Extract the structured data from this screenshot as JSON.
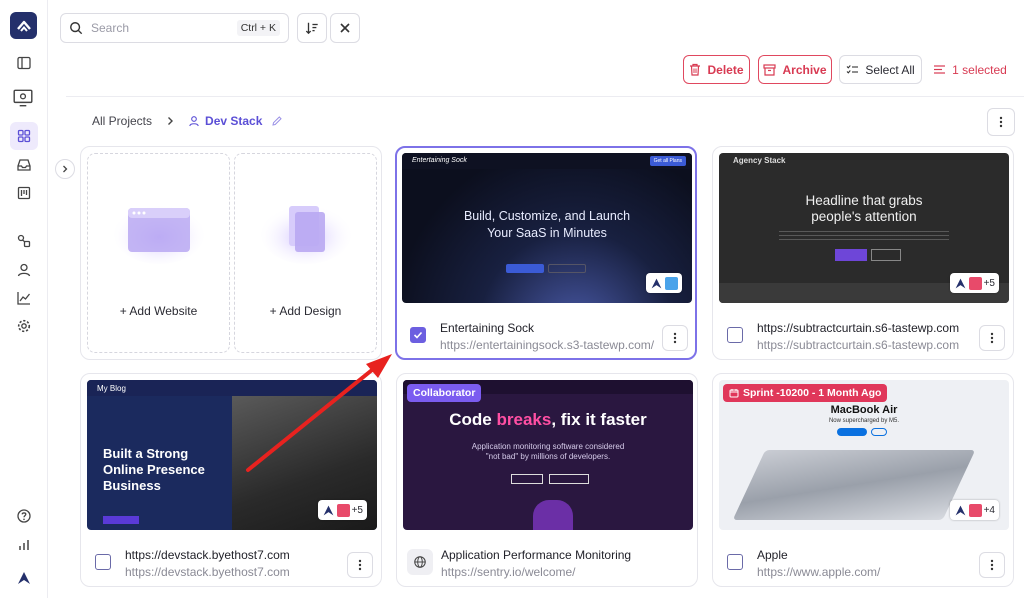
{
  "search": {
    "placeholder": "Search",
    "shortcut": "Ctrl + K"
  },
  "toolbar": {
    "delete_label": "Delete",
    "archive_label": "Archive",
    "select_all_label": "Select All",
    "selected_count": "1 selected"
  },
  "breadcrumb": {
    "root": "All Projects",
    "current": "Dev Stack"
  },
  "add_cards": {
    "website": "+ Add Website",
    "design": "+ Add Design"
  },
  "projects": [
    {
      "title": "Entertaining Sock",
      "url": "https://entertainingsock.s3-tastewp.com/",
      "selected": true,
      "thumb": {
        "brand": "Entertaining Sock",
        "cta": "Get all Plans",
        "headline": "Build, Customize, and Launch\nYour SaaS in Minutes"
      }
    },
    {
      "title": "https://subtractcurtain.s6-tastewp.com",
      "url": "https://subtractcurtain.s6-tastewp.com",
      "selected": false,
      "badge_count": "+5",
      "thumb": {
        "brand": "Agency Stack",
        "headline": "Headline that grabs\npeople's attention"
      }
    },
    {
      "title": "https://devstack.byethost7.com",
      "url": "https://devstack.byethost7.com",
      "selected": false,
      "badge_count": "+5",
      "thumb": {
        "brand": "My Blog",
        "headline": "Built a Strong\nOnline Presence\nBusiness"
      }
    },
    {
      "title": "Application Performance Monitoring",
      "url": "https://sentry.io/welcome/",
      "tag": "Collaborator",
      "thumb": {
        "headline_a": "Code ",
        "headline_b": "breaks",
        "headline_c": ", fix it faster",
        "sub": "Application monitoring software considered\n\"not bad\" by millions of developers."
      }
    },
    {
      "title": "Apple",
      "url": "https://www.apple.com/",
      "selected": false,
      "badge_count": "+4",
      "tag": "Sprint -10200 - 1 Month Ago",
      "thumb": {
        "headline": "MacBook Air",
        "sub": "Now supercharged by M5."
      }
    }
  ],
  "colors": {
    "accent": "#6c5fe0",
    "danger": "#d83a52",
    "logo_bg": "#24306b",
    "collaborator": "#7b5cf0",
    "sprint": "#e0375a"
  }
}
